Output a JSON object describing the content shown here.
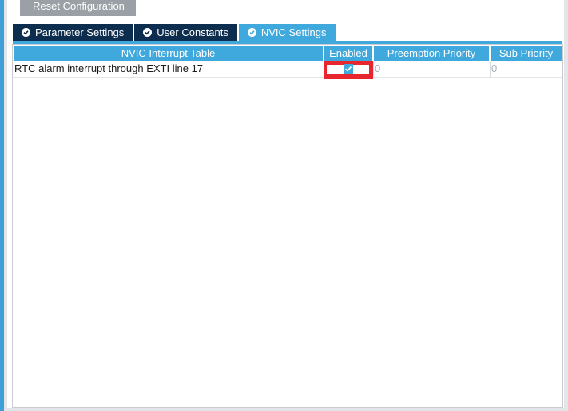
{
  "toolbar": {
    "reset_label": "Reset Configuration"
  },
  "tabs": [
    {
      "label": "Parameter Settings",
      "active": false
    },
    {
      "label": "User Constants",
      "active": false
    },
    {
      "label": "NVIC Settings",
      "active": true
    }
  ],
  "table": {
    "columns": [
      "NVIC Interrupt Table",
      "Enabled",
      "Preemption Priority",
      "Sub Priority"
    ],
    "rows": [
      {
        "name": "RTC alarm interrupt through EXTI line 17",
        "enabled": true,
        "preemption_priority": "0",
        "sub_priority": "0"
      }
    ]
  },
  "colors": {
    "accent": "#3fa9dd",
    "tab_inactive": "#0d2d4f",
    "button_bg": "#9aa0a5",
    "highlight": "#e8262d"
  },
  "icons": {
    "tab_status": "check-circle-icon",
    "enabled_state": "checkbox-checked-icon"
  }
}
